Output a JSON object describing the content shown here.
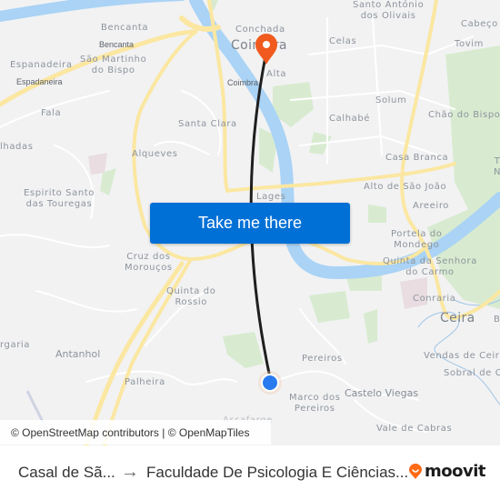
{
  "map": {
    "places": [
      {
        "name": "Bencanta",
        "style": "normal"
      },
      {
        "name": "Bencanta",
        "style": "dark"
      },
      {
        "name": "Espanadeira",
        "style": "normal"
      },
      {
        "name": "Espadaneira",
        "style": "dark"
      },
      {
        "name": "São Martinho\ndo Bispo",
        "style": "normal"
      },
      {
        "name": "Fala",
        "style": "normal"
      },
      {
        "name": "lhadas",
        "style": "normal"
      },
      {
        "name": "Santa Clara",
        "style": "normal"
      },
      {
        "name": "Alqueves",
        "style": "normal"
      },
      {
        "name": "Espirito Santo\ndas Touregas",
        "style": "normal"
      },
      {
        "name": "Cruz dos\nMorouços",
        "style": "normal"
      },
      {
        "name": "Quinta do\nRossio",
        "style": "normal"
      },
      {
        "name": "rgaria",
        "style": "normal"
      },
      {
        "name": "Antanhol",
        "style": "normal"
      },
      {
        "name": "Palheira",
        "style": "normal"
      },
      {
        "name": "Conchada",
        "style": "normal"
      },
      {
        "name": "Coimbra",
        "style": "big"
      },
      {
        "name": "Alta",
        "style": "normal"
      },
      {
        "name": "Coimbra",
        "style": "dark"
      },
      {
        "name": "Santo António\ndos Olivais",
        "style": "normal"
      },
      {
        "name": "Celas",
        "style": "normal"
      },
      {
        "name": "Cabeço",
        "style": "normal"
      },
      {
        "name": "Tovim",
        "style": "normal"
      },
      {
        "name": "Solum",
        "style": "normal"
      },
      {
        "name": "Calhabé",
        "style": "normal"
      },
      {
        "name": "Chão do Bispo",
        "style": "normal"
      },
      {
        "name": "Casa Branca",
        "style": "normal"
      },
      {
        "name": "Lages",
        "style": "normal"
      },
      {
        "name": "Alto de São João",
        "style": "normal"
      },
      {
        "name": "Areeiro",
        "style": "normal"
      },
      {
        "name": "Portela do\nMondego",
        "style": "normal"
      },
      {
        "name": "Quinta da Senhora\ndo Carmo",
        "style": "normal"
      },
      {
        "name": "Conraria",
        "style": "normal"
      },
      {
        "name": "Ceira",
        "style": "big"
      },
      {
        "name": "B",
        "style": "normal"
      },
      {
        "name": "Vendas de Ceira",
        "style": "normal"
      },
      {
        "name": "Sobral de C",
        "style": "normal"
      },
      {
        "name": "Pereiros",
        "style": "normal"
      },
      {
        "name": "Marco dos\nPereiros",
        "style": "normal"
      },
      {
        "name": "Castelo Viegas",
        "style": "normal"
      },
      {
        "name": "Vale de Cabras",
        "style": "normal"
      },
      {
        "name": "Assafarge",
        "style": "normal"
      },
      {
        "name": "T\nN",
        "style": "normal"
      }
    ],
    "route": {
      "from_marker": "origin-dot",
      "to_marker": "destination-pin"
    },
    "colors": {
      "land": "#f2f2f3",
      "water": "#aad3f5",
      "park": "#d8ebd0",
      "road_major": "#fbe7a1",
      "road_minor": "#ffffff",
      "route_line": "#1f1f1f",
      "destination_pin": "#f05a1f",
      "origin_dot": "#2a7bf0",
      "cta_bg": "#0070d6"
    }
  },
  "cta": {
    "label": "Take me there"
  },
  "attribution": {
    "osm": "© OpenStreetMap contributors",
    "sep": " | ",
    "omt": "© OpenMapTiles"
  },
  "footer": {
    "from": "Casal de Sã...",
    "arrow": "→",
    "to": "Faculdade De Psicologia E Ciências...",
    "brand": "moovit",
    "brand_color": "#ff6a13"
  }
}
